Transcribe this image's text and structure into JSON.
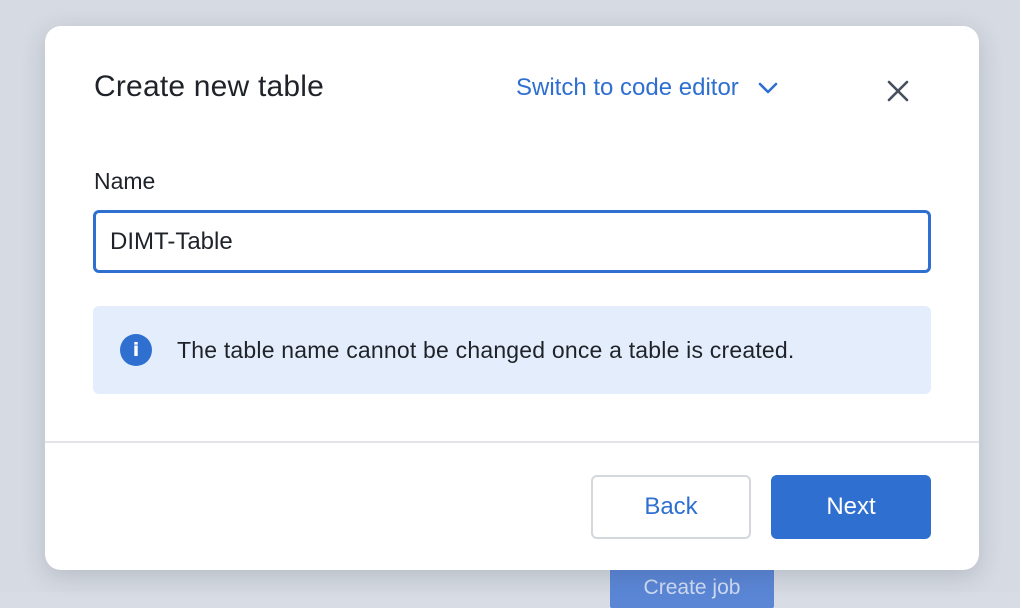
{
  "background": {
    "partial_button_label": "Create job"
  },
  "dialog": {
    "title": "Create new table",
    "switch_link_label": "Switch to code editor",
    "name_label": "Name",
    "name_value": "DIMT-Table",
    "info_icon_glyph": "i",
    "info_message": "The table name cannot be changed once a table is created.",
    "back_label": "Back",
    "next_label": "Next"
  },
  "icons": {
    "switch_link": "chevron-down-icon",
    "close": "close-icon",
    "info": "info-icon"
  },
  "colors": {
    "accent": "#2f6fd0",
    "info_background": "#e3edfb",
    "text": "#1f2329",
    "backdrop": "#d6dae2"
  }
}
